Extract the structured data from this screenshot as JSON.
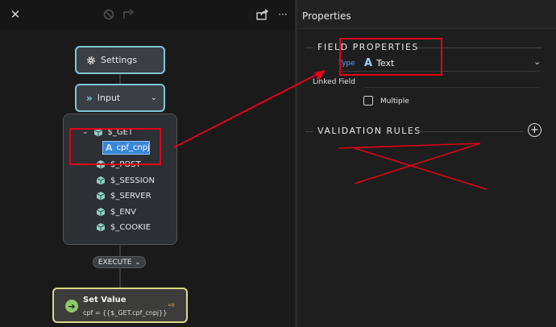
{
  "toolbar": {
    "close_icon": "close-icon",
    "disabled_icon": "no-entry-icon",
    "forward_icon": "forward-icon",
    "share_icon": "share-icon",
    "more_label": "···"
  },
  "flow": {
    "settings_label": "Settings",
    "input_label": "Input",
    "tree": {
      "root": "$_GET",
      "selected_child": "cpf_cnpj",
      "items": [
        "$_POST",
        "$_SESSION",
        "$_SERVER",
        "$_ENV",
        "$_COOKIE"
      ]
    },
    "execute_label": "EXECUTE",
    "set_value": {
      "title": "Set Value",
      "expression": "cpf = {{$_GET.cpf_cnpj}}"
    }
  },
  "properties": {
    "header": "Properties",
    "field_properties_title": "FIELD PROPERTIES",
    "type_label": "Type",
    "type_value": "Text",
    "linked_field_label": "Linked Field",
    "multiple_label": "Multiple",
    "validation_rules_title": "VALIDATION RULES"
  },
  "colors": {
    "accent_node_border": "#7fc6d6",
    "selection_blue": "#3a86d8",
    "annotation_red": "#e2001a",
    "set_value_border": "#d9d98a",
    "type_label_blue": "#4da3ff"
  }
}
